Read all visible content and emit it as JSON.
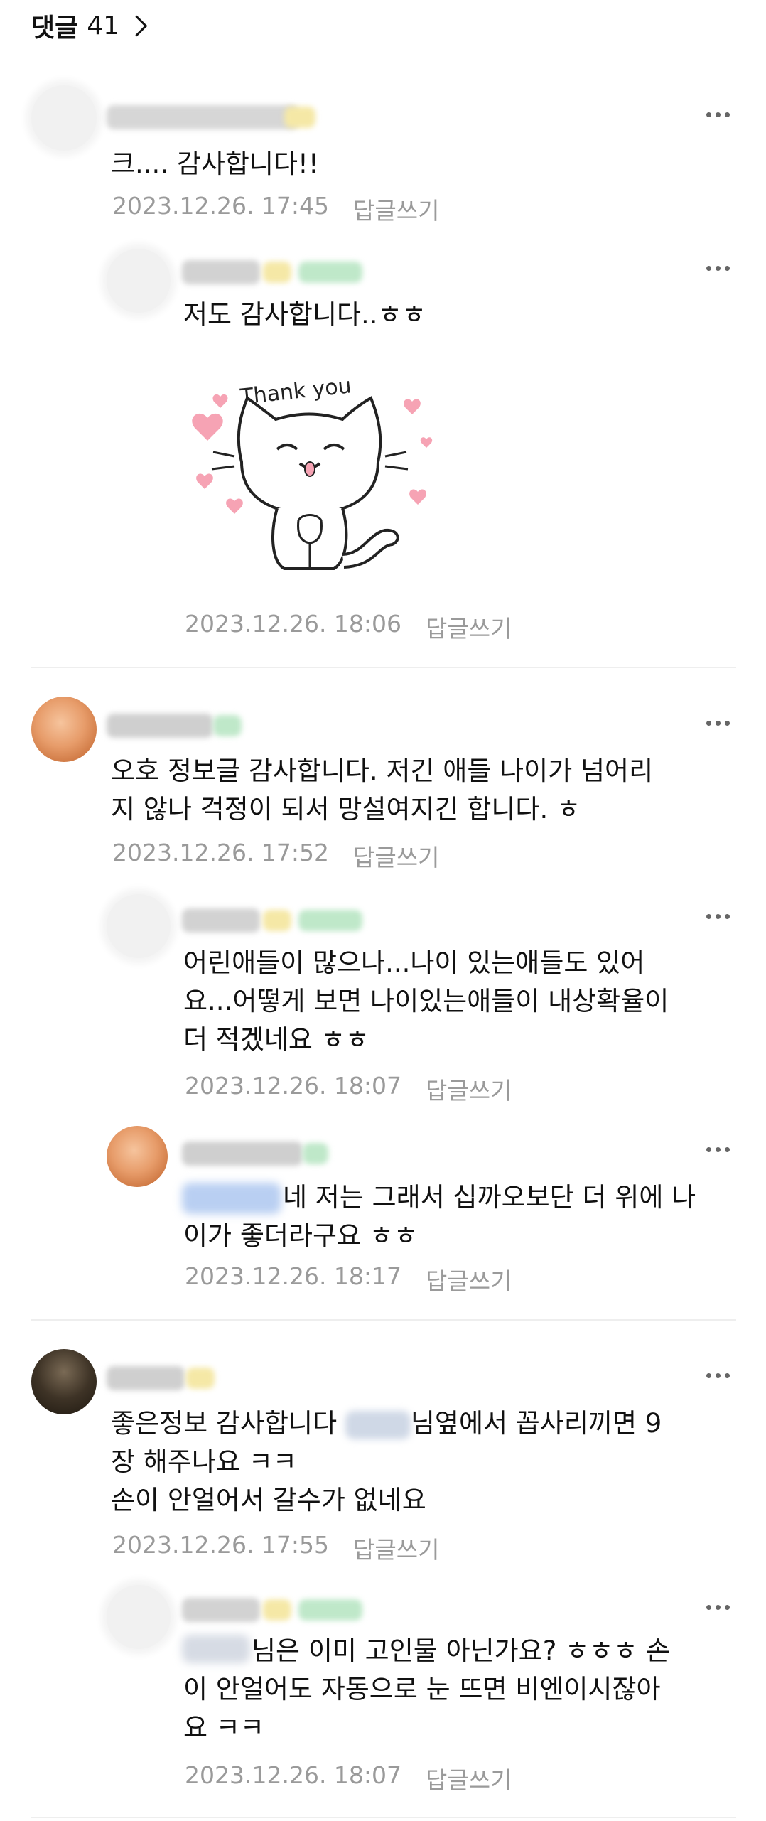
{
  "header": {
    "title": "댓글",
    "count": "41"
  },
  "comments": [
    {
      "text": "크.... 감사합니다!!",
      "date": "2023.12.26. 17:45",
      "reply": "답글쓰기"
    },
    {
      "text": "저도 감사합니다..ㅎㅎ",
      "date": "2023.12.26. 18:06",
      "reply": "답글쓰기",
      "sticker": {
        "label": "Thank you",
        "colors": {
          "heart": "#f6a3b4",
          "outline": "#222222"
        }
      }
    },
    {
      "text": "오호 정보글 감사합니다. 저긴 애들 나이가 넘어리\n지 않나 걱정이 되서 망설여지긴 합니다. ㅎ",
      "date": "2023.12.26. 17:52",
      "reply": "답글쓰기"
    },
    {
      "text": "어린애들이 많으나...나이 있는애들도 있어\n요...어떻게 보면 나이있는애들이 내상확율이\n더 적겠네요 ㅎㅎ",
      "date": "2023.12.26. 18:07",
      "reply": "답글쓰기"
    },
    {
      "text": "네 저는 그래서 십까오보단 더 위에 나\n이가 좋더라구요 ㅎㅎ",
      "date": "2023.12.26. 18:17",
      "reply": "답글쓰기"
    },
    {
      "text_a": "좋은정보 감사합니다 ",
      "text_b": "님옆에서 꼽사리끼면 9\n장 해주나요 ㅋㅋ\n손이 안얼어서 갈수가 없네요",
      "date": "2023.12.26. 17:55",
      "reply": "답글쓰기"
    },
    {
      "text": "님은 이미 고인물 아닌가요? ㅎㅎㅎ 손\n이 안얼어도 자동으로 눈 뜨면 비엔이시잖아\n요 ㅋㅋ",
      "date": "2023.12.26. 18:07",
      "reply": "답글쓰기"
    }
  ],
  "icons": {
    "more": "more-horizontal-icon",
    "chevron": "chevron-right-icon"
  },
  "colors": {
    "meta": "#9a9a9a",
    "divider": "#eeeeee",
    "badge_yellow": "#f5e8a6",
    "badge_green": "#bfe8c9"
  }
}
